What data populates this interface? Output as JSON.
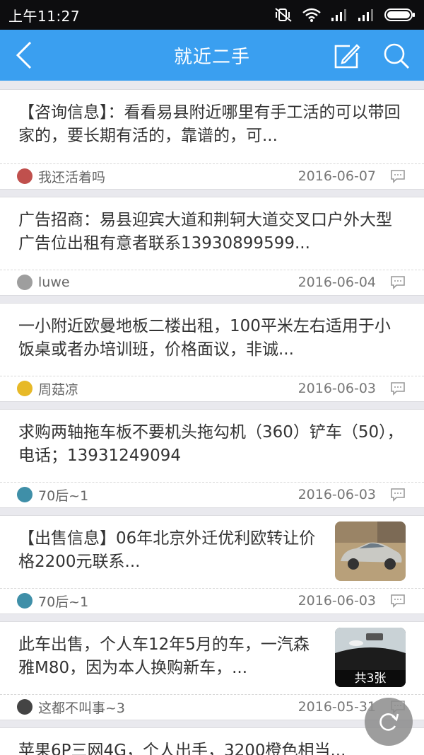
{
  "status_bar": {
    "time": "上午11:27",
    "icons": [
      "mute-vibrate-icon",
      "wifi-icon",
      "signal-icon",
      "signal-icon",
      "battery-icon"
    ]
  },
  "nav": {
    "title": "就近二手",
    "back_icon": "chevron-left-icon",
    "edit_icon": "compose-icon",
    "search_icon": "search-icon"
  },
  "posts": [
    {
      "title": "【咨询信息】：看看易县附近哪里有手工活的可以带回家的，要长期有活的，靠谱的，可...",
      "author": "我还活着吗",
      "date": "2016-06-07",
      "avatar_color": "#c0504d"
    },
    {
      "title": "广告招商：易县迎宾大道和荆轲大道交叉口户外大型广告位出租有意者联系13930899599...",
      "author": "luwe",
      "date": "2016-06-04",
      "avatar_color": "#9e9e9e"
    },
    {
      "title": "一小附近欧曼地板二楼出租，100平米左右适用于小饭桌或者办培训班，价格面议，非诚...",
      "author": "周菇凉",
      "date": "2016-06-03",
      "avatar_color": "#e7b928"
    },
    {
      "title": "求购两轴拖车板不要机头拖勾机（360）铲车（50），电话；13931249094",
      "author": "70后~1",
      "date": "2016-06-03",
      "avatar_color": "#3f8fa8"
    },
    {
      "title": "【出售信息】06年北京外迁优利欧转让价格2200元联系...",
      "author": "70后~1",
      "date": "2016-06-03",
      "avatar_color": "#3f8fa8",
      "thumb": "car-photo"
    },
    {
      "title": "此车出售，个人车12年5月的车，一汽森雅M80，因为本人换购新车，...",
      "author": "这都不叫事~3",
      "date": "2016-05-31",
      "avatar_color": "#444444",
      "thumb": "car-interior-photo",
      "thumb_badge": "共3张"
    },
    {
      "title": "苹果6P三网4G，个人出手，3200橙色相当..."
    }
  ],
  "fab_icon": "refresh-icon"
}
